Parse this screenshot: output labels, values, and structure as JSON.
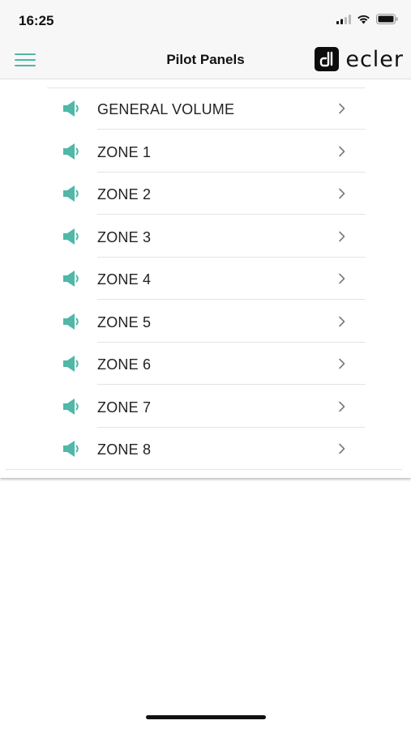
{
  "status_bar": {
    "time": "16:25",
    "icons": [
      "signal-icon",
      "wifi-icon",
      "battery-icon"
    ]
  },
  "nav": {
    "title": "Pilot Panels",
    "logo_text": "ecler",
    "menu_icon": "hamburger-menu-icon"
  },
  "colors": {
    "accent": "#4fb8a6",
    "background": "#f7f7f7"
  },
  "list": {
    "items": [
      {
        "label": "GENERAL VOLUME",
        "icon": "speaker-icon"
      },
      {
        "label": "ZONE 1",
        "icon": "speaker-icon"
      },
      {
        "label": "ZONE 2",
        "icon": "speaker-icon"
      },
      {
        "label": "ZONE 3",
        "icon": "speaker-icon"
      },
      {
        "label": "ZONE 4",
        "icon": "speaker-icon"
      },
      {
        "label": "ZONE 5",
        "icon": "speaker-icon"
      },
      {
        "label": "ZONE 6",
        "icon": "speaker-icon"
      },
      {
        "label": "ZONE 7",
        "icon": "speaker-icon"
      },
      {
        "label": "ZONE 8",
        "icon": "speaker-icon"
      }
    ]
  }
}
